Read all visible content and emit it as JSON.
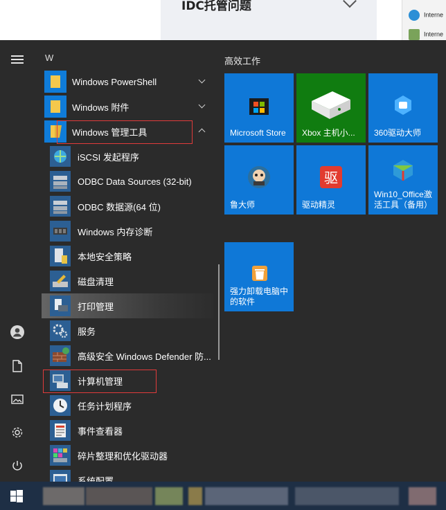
{
  "background_window": {
    "card_title": "IDC托管问题",
    "side_items": [
      "Interne",
      "Interne"
    ]
  },
  "start_menu": {
    "letter_heading": "W",
    "folders": [
      {
        "label": "Windows PowerShell",
        "expanded": false
      },
      {
        "label": "Windows 附件",
        "expanded": false
      },
      {
        "label": "Windows 管理工具",
        "expanded": true
      }
    ],
    "admin_tools": [
      {
        "label": "iSCSI 发起程序",
        "icon": "iscsi-globe-icon"
      },
      {
        "label": "ODBC Data Sources (32-bit)",
        "icon": "odbc-server-icon"
      },
      {
        "label": "ODBC 数据源(64 位)",
        "icon": "odbc-server-icon"
      },
      {
        "label": "Windows 内存诊断",
        "icon": "memory-chip-icon"
      },
      {
        "label": "本地安全策略",
        "icon": "security-policy-icon"
      },
      {
        "label": "磁盘清理",
        "icon": "disk-cleanup-icon"
      },
      {
        "label": "打印管理",
        "icon": "print-management-icon"
      },
      {
        "label": "服务",
        "icon": "gears-icon"
      },
      {
        "label": "高级安全 Windows Defender 防...",
        "icon": "firewall-icon"
      },
      {
        "label": "计算机管理",
        "icon": "computer-management-icon"
      },
      {
        "label": "任务计划程序",
        "icon": "task-scheduler-icon"
      },
      {
        "label": "事件查看器",
        "icon": "event-viewer-icon"
      },
      {
        "label": "碎片整理和优化驱动器",
        "icon": "defrag-icon"
      },
      {
        "label": "系统配置",
        "icon": "system-config-icon"
      }
    ],
    "tiles_group_title": "高效工作",
    "tiles": [
      {
        "label": "Microsoft Store",
        "color": "#0f78d7",
        "icon": "store-bag-icon"
      },
      {
        "label": "Xbox 主机小...",
        "color": "#107c10",
        "icon": "xbox-console-icon"
      },
      {
        "label": "360驱动大师",
        "color": "#0f78d7",
        "icon": "driver-360-icon"
      },
      {
        "label": "鲁大师",
        "color": "#0f78d7",
        "icon": "ludashi-icon"
      },
      {
        "label": "驱动精灵",
        "color": "#0f78d7",
        "icon": "driver-genius-icon"
      },
      {
        "label": "Win10_Office激活工具（备用）",
        "color": "#0f78d7",
        "icon": "office-activation-icon"
      },
      {
        "label": "强力卸载电脑中的软件",
        "color": "#0f78d7",
        "icon": "uninstaller-icon"
      }
    ]
  }
}
